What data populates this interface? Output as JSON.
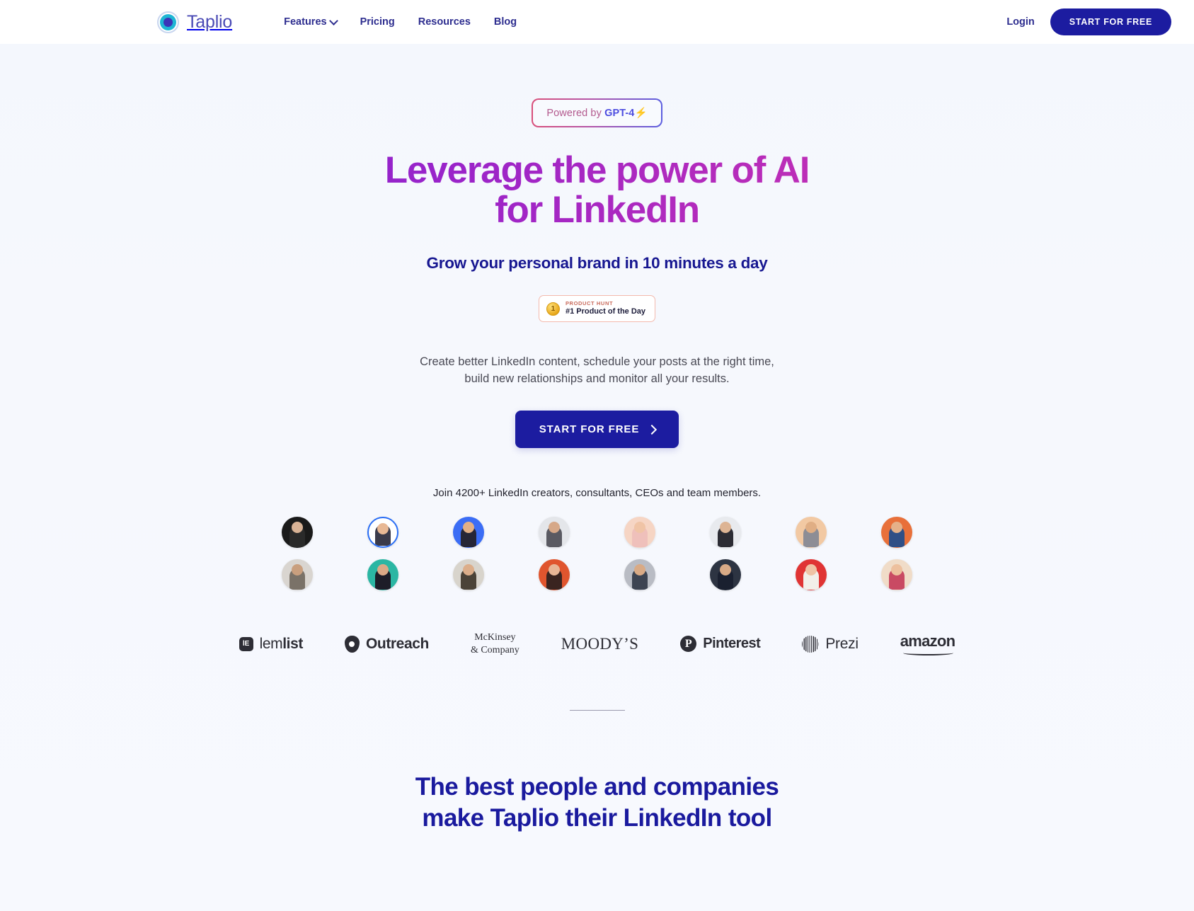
{
  "brand": {
    "name": "Taplio",
    "logo_icon": "taplio-target-icon"
  },
  "nav": {
    "links": [
      {
        "label": "Features",
        "has_dropdown": true,
        "icon": "chevron-down-icon"
      },
      {
        "label": "Pricing",
        "has_dropdown": false
      },
      {
        "label": "Resources",
        "has_dropdown": false
      },
      {
        "label": "Blog",
        "has_dropdown": false
      }
    ],
    "login_label": "Login",
    "cta_label": "START FOR FREE"
  },
  "hero": {
    "badge": {
      "prefix": "Powered by ",
      "highlight": "GPT-4",
      "spark_icon": "lightning-icon"
    },
    "title_line1": "Leverage the power of AI",
    "title_line2": "for LinkedIn",
    "subtitle": "Grow your personal brand in 10 minutes a day",
    "product_hunt": {
      "medal_icon": "medal-icon",
      "kicker": "PRODUCT HUNT",
      "title": "#1 Product of the Day"
    },
    "description_line1": "Create better LinkedIn content, schedule your posts at the right time,",
    "description_line2": "build new relationships and monitor all your results.",
    "cta_label": "START FOR FREE",
    "cta_icon": "chevron-right-icon",
    "join_text": "Join 4200+ LinkedIn creators, consultants, CEOs and team members."
  },
  "avatars": {
    "row1": [
      {
        "name": "avatar-1",
        "bg": "#1a1a1a",
        "head": "#d8b295",
        "body": "#2a2a2a"
      },
      {
        "name": "avatar-2",
        "bg": "#ffffff",
        "head": "#e8b894",
        "body": "#3a3a4a",
        "ring": true
      },
      {
        "name": "avatar-3",
        "bg": "#3b6df5",
        "head": "#e2b086",
        "body": "#262636"
      },
      {
        "name": "avatar-4",
        "bg": "#e4e6ea",
        "head": "#d6a888",
        "body": "#5a5a62"
      },
      {
        "name": "avatar-5",
        "bg": "#f6d5c4",
        "head": "#f0c4a6",
        "body": "#efc0bb"
      },
      {
        "name": "avatar-6",
        "bg": "#e8eaee",
        "head": "#ddb494",
        "body": "#2c2c34"
      },
      {
        "name": "avatar-7",
        "bg": "#f2c9a3",
        "head": "#e0ae84",
        "body": "#8d8d95"
      },
      {
        "name": "avatar-8",
        "bg": "#e8703a",
        "head": "#e5b189",
        "body": "#2f4f86"
      }
    ],
    "row2": [
      {
        "name": "avatar-9",
        "bg": "#d9d5d0",
        "head": "#c99f7e",
        "body": "#7a7268"
      },
      {
        "name": "avatar-10",
        "bg": "#2bb6a3",
        "head": "#dba986",
        "body": "#1d1d28"
      },
      {
        "name": "avatar-11",
        "bg": "#d8d4cc",
        "head": "#dcae8a",
        "body": "#4b4338"
      },
      {
        "name": "avatar-12",
        "bg": "#e0552e",
        "head": "#e8b696",
        "body": "#3a2420"
      },
      {
        "name": "avatar-13",
        "bg": "#b9bcc4",
        "head": "#d9aa85",
        "body": "#3d4452"
      },
      {
        "name": "avatar-14",
        "bg": "#2d3442",
        "head": "#d8aa86",
        "body": "#1a2030"
      },
      {
        "name": "avatar-15",
        "bg": "#e03434",
        "head": "#efc3a5",
        "body": "#f2efe9"
      },
      {
        "name": "avatar-16",
        "bg": "#f0dcc8",
        "head": "#edc09e",
        "body": "#c94a63"
      }
    ]
  },
  "logos": [
    {
      "name": "lemlist",
      "mark": "lemlist-square-icon",
      "mark_text": "lE",
      "text_light": "lem",
      "text_bold": "list"
    },
    {
      "name": "outreach",
      "mark": "outreach-pin-icon",
      "text": "Outreach"
    },
    {
      "name": "mckinsey",
      "line1": "McKinsey",
      "line2": "& Company"
    },
    {
      "name": "moodys",
      "text": "MOODY’S"
    },
    {
      "name": "pinterest",
      "mark": "pinterest-p-icon",
      "mark_text": "P",
      "text": "Pinterest"
    },
    {
      "name": "prezi",
      "mark": "prezi-disc-icon",
      "text": "Prezi"
    },
    {
      "name": "amazon",
      "text": "amazon",
      "smile_icon": "amazon-smile-icon"
    }
  ],
  "bottom_section": {
    "title_line1": "The best people and companies",
    "title_line2": "make Taplio their LinkedIn tool"
  },
  "colors": {
    "primary_blue": "#1c1ca0",
    "nav_text": "#2d2d8f",
    "brand_purple": "#4a4ab5",
    "heading_gradient_start": "#7b1fd4",
    "heading_gradient_end": "#d0349f",
    "page_bg": "#f5f8fd",
    "bottom_heading": "#1a1a9e"
  }
}
